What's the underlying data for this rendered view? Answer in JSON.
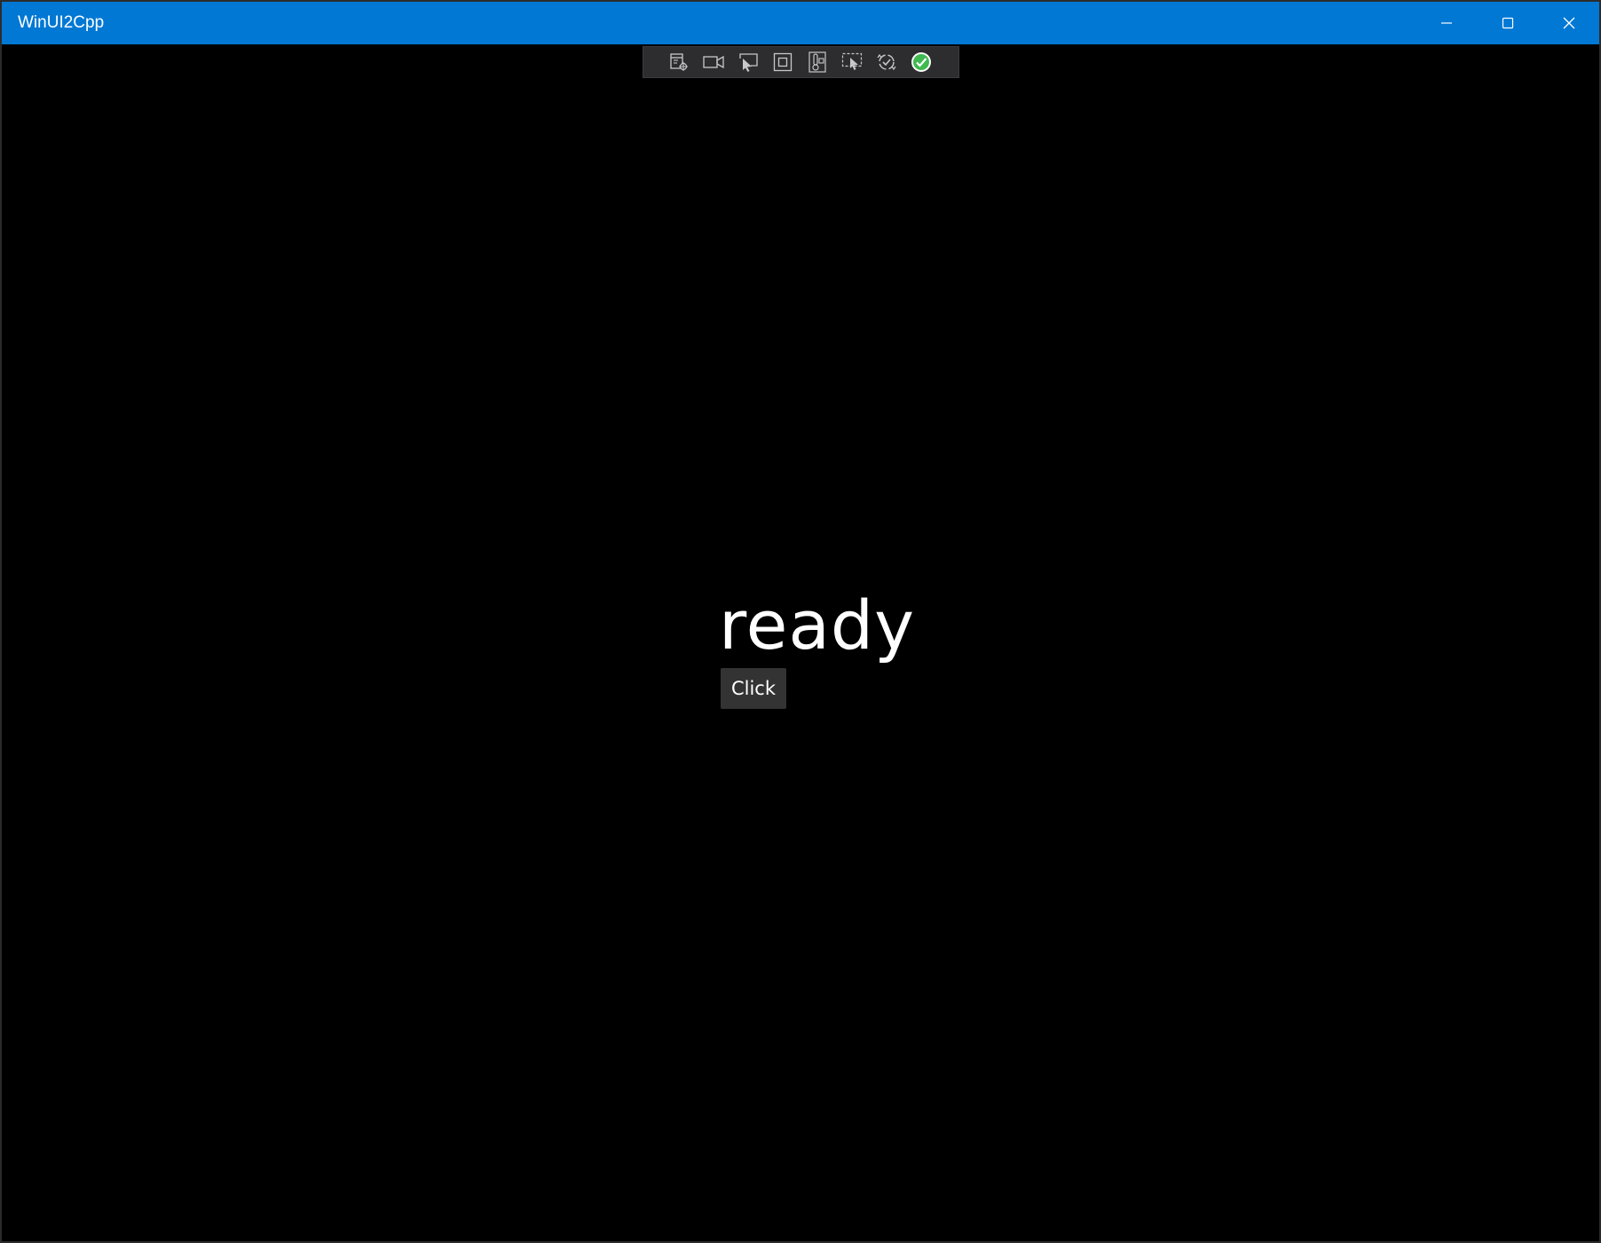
{
  "window": {
    "title": "WinUI2Cpp",
    "accent_color": "#0078d4",
    "background_color": "#000000"
  },
  "caption_buttons": {
    "minimize_icon": "minimize-icon",
    "maximize_icon": "maximize-icon",
    "close_icon": "close-icon"
  },
  "debug_toolbar": {
    "items": [
      {
        "icon": "live-visual-tree-icon"
      },
      {
        "icon": "record-icon"
      },
      {
        "icon": "select-element-icon"
      },
      {
        "icon": "display-layout-adorners-icon"
      },
      {
        "icon": "track-focus-icon"
      },
      {
        "icon": "preview-selection-icon"
      },
      {
        "icon": "hot-reload-icon"
      },
      {
        "icon": "status-ok-icon"
      }
    ],
    "status_color": "#3fb950"
  },
  "main": {
    "status_text": "ready",
    "button_label": "Click"
  }
}
